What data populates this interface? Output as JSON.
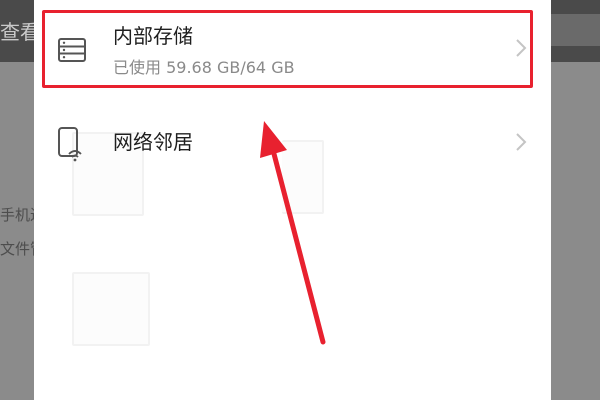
{
  "background": {
    "header_fragment": "查看",
    "side_text_1": "手机进入",
    "side_text_2": "文件管理"
  },
  "dialog": {
    "items": [
      {
        "title": "内部存储",
        "subtitle": "已使用 59.68 GB/64 GB",
        "icon": "storage-icon"
      },
      {
        "title": "网络邻居",
        "icon": "network-device-icon"
      }
    ]
  },
  "annotation": {
    "highlight_color": "#e8212f",
    "arrow_color": "#e8212f"
  },
  "colors": {
    "title_text": "#1f1f1f",
    "subtitle_text": "#8a8a8a",
    "chevron": "#c4c4c4",
    "overlay_dim": "#8f8f8f"
  }
}
